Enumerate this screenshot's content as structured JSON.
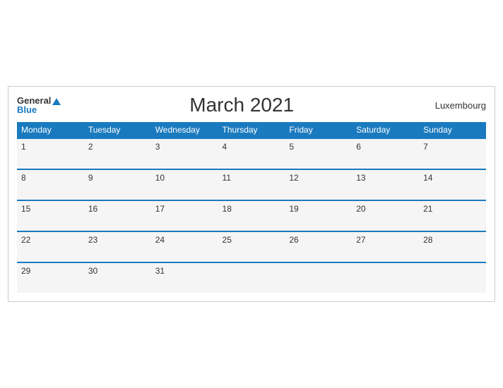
{
  "header": {
    "logo_general": "General",
    "logo_blue": "Blue",
    "title": "March 2021",
    "country": "Luxembourg"
  },
  "days": [
    "Monday",
    "Tuesday",
    "Wednesday",
    "Thursday",
    "Friday",
    "Saturday",
    "Sunday"
  ],
  "weeks": [
    [
      "1",
      "2",
      "3",
      "4",
      "5",
      "6",
      "7"
    ],
    [
      "8",
      "9",
      "10",
      "11",
      "12",
      "13",
      "14"
    ],
    [
      "15",
      "16",
      "17",
      "18",
      "19",
      "20",
      "21"
    ],
    [
      "22",
      "23",
      "24",
      "25",
      "26",
      "27",
      "28"
    ],
    [
      "29",
      "30",
      "31",
      "",
      "",
      "",
      ""
    ]
  ]
}
